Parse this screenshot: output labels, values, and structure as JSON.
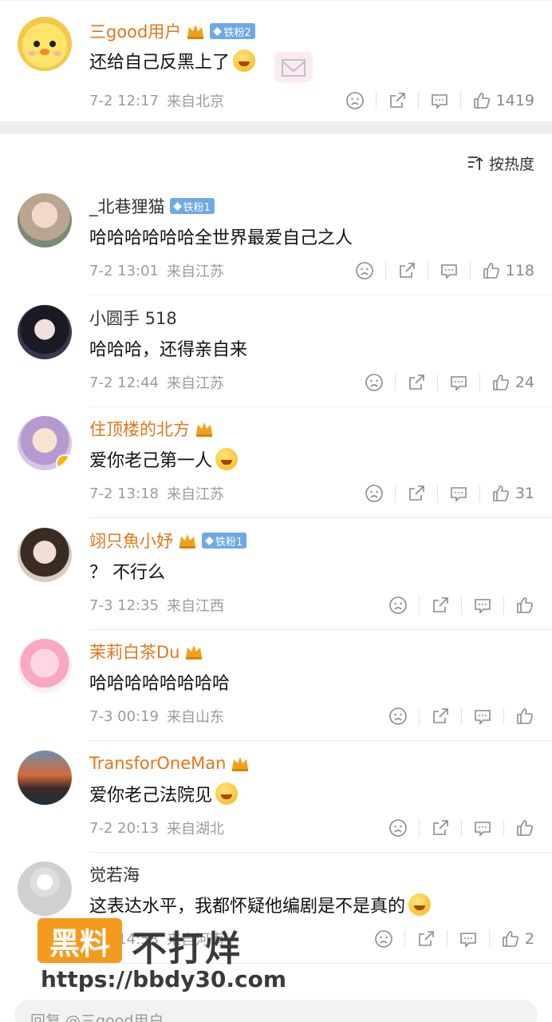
{
  "top_comment": {
    "name": "三good用户",
    "badge": "铁粉2",
    "text": "还给自己反黑上了",
    "time": "7-2 12:17",
    "location": "来自北京",
    "likes": "1419"
  },
  "sort": {
    "label": "按热度"
  },
  "comments": [
    {
      "name": "_北巷狸猫",
      "name_style": "plain",
      "crown": false,
      "badge": "铁粉1",
      "text": "哈哈哈哈哈哈全世界最爱自己之人",
      "emoji": false,
      "time": "7-2 13:01",
      "location": "来自江苏",
      "likes": "118"
    },
    {
      "name": "小圆手 518",
      "name_style": "plain",
      "crown": false,
      "badge": "",
      "text": "哈哈哈，还得亲自来",
      "emoji": false,
      "time": "7-2 12:44",
      "location": "来自江苏",
      "likes": "24"
    },
    {
      "name": "住顶楼的北方",
      "name_style": "orange",
      "crown": true,
      "badge": "",
      "text": "爱你老己第一人",
      "emoji": true,
      "time": "7-2 13:18",
      "location": "来自江苏",
      "likes": "31"
    },
    {
      "name": "翊只魚小妤",
      "name_style": "orange",
      "crown": true,
      "badge": "铁粉1",
      "text": "？ 不行么",
      "emoji": false,
      "time": "7-3 12:35",
      "location": "来自江西",
      "likes": ""
    },
    {
      "name": "茉莉白茶Du",
      "name_style": "orange",
      "crown": true,
      "badge": "",
      "text": "哈哈哈哈哈哈哈哈",
      "emoji": false,
      "time": "7-3 00:19",
      "location": "来自山东",
      "likes": ""
    },
    {
      "name": "TransforOneMan",
      "name_style": "orange",
      "crown": true,
      "badge": "",
      "text": "爱你老己法院见",
      "emoji": true,
      "time": "7-2 20:13",
      "location": "来自湖北",
      "likes": ""
    },
    {
      "name": "觉若海",
      "name_style": "plain",
      "crown": false,
      "badge": "",
      "text": "这表达水平，我都怀疑他编剧是不是真的",
      "emoji": true,
      "time": "7-2 14:53",
      "location": "来自河南",
      "likes": "2"
    }
  ],
  "watermark": {
    "box": "黑料",
    "text": "不打烊",
    "url": "https://bbdy30.com"
  },
  "reply_bar": {
    "placeholder": "回复 @三good用户"
  },
  "colors": {
    "name_orange": "#e2761a",
    "badge_blue": "#6ea8e8",
    "meta_gray": "#9b9b9b",
    "watermark_orange": "#f39a1f"
  }
}
